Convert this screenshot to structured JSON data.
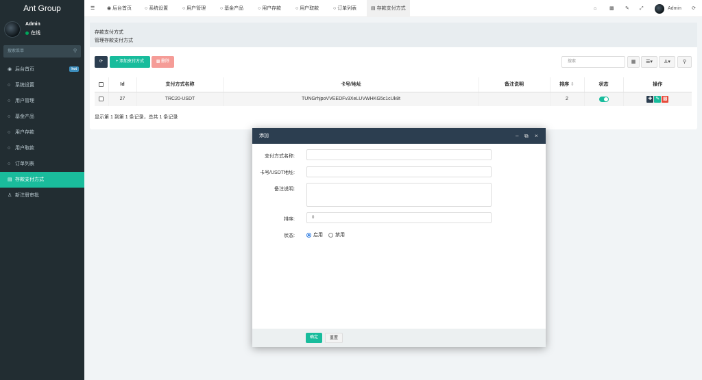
{
  "brand": "Ant Group",
  "user": {
    "name": "Admin",
    "status": "在线"
  },
  "sidebar": {
    "search_placeholder": "搜索菜单",
    "items": [
      {
        "label": "后台首页",
        "icon": "dashboard-icon",
        "badge": "hot"
      },
      {
        "label": "系统设置",
        "icon": "circle-icon"
      },
      {
        "label": "用户管理",
        "icon": "circle-icon"
      },
      {
        "label": "基金产品",
        "icon": "circle-icon"
      },
      {
        "label": "用户存款",
        "icon": "circle-icon"
      },
      {
        "label": "用户取款",
        "icon": "circle-icon"
      },
      {
        "label": "订单列表",
        "icon": "circle-icon"
      },
      {
        "label": "存款支付方式",
        "icon": "card-icon",
        "active": true
      },
      {
        "label": "新注册审批",
        "icon": "user-add-icon"
      }
    ]
  },
  "topbar": {
    "tabs": [
      "后台首页",
      "系统设置",
      "用户管理",
      "基金产品",
      "用户存款",
      "用户取款",
      "订单列表",
      "存款支付方式"
    ],
    "admin_label": "Admin"
  },
  "page": {
    "title": "存款支付方式",
    "subtitle": "管理存款支付方式"
  },
  "toolbar": {
    "add_label": "添加支付方式",
    "delete_label": "删除",
    "search_placeholder": "搜索"
  },
  "table": {
    "columns": [
      "Id",
      "支付方式名称",
      "卡号/地址",
      "备注说明",
      "排序",
      "状态",
      "操作"
    ],
    "rows": [
      {
        "id": "27",
        "name": "TRC20-USDT",
        "address": "TUNGrhjpoVVEEDFv3XeLUVWHKG5c1cUk8t",
        "remark": "",
        "sort": "2",
        "status": true
      }
    ],
    "footer": "显示第 1 到第 1 条记录，总共 1 条记录"
  },
  "modal": {
    "title": "添加",
    "fields": {
      "name_label": "支付方式名称:",
      "address_label": "卡号/USDT地址:",
      "remark_label": "备注说明:",
      "sort_label": "排序:",
      "sort_value": "0",
      "status_label": "状态:",
      "status_on": "启用",
      "status_off": "禁用"
    },
    "ok_label": "确定",
    "reset_label": "重置"
  },
  "colors": {
    "sidebar": "#222d32",
    "accent": "#18bc9c",
    "header": "#2c3e50",
    "danger": "#e74c3c"
  }
}
